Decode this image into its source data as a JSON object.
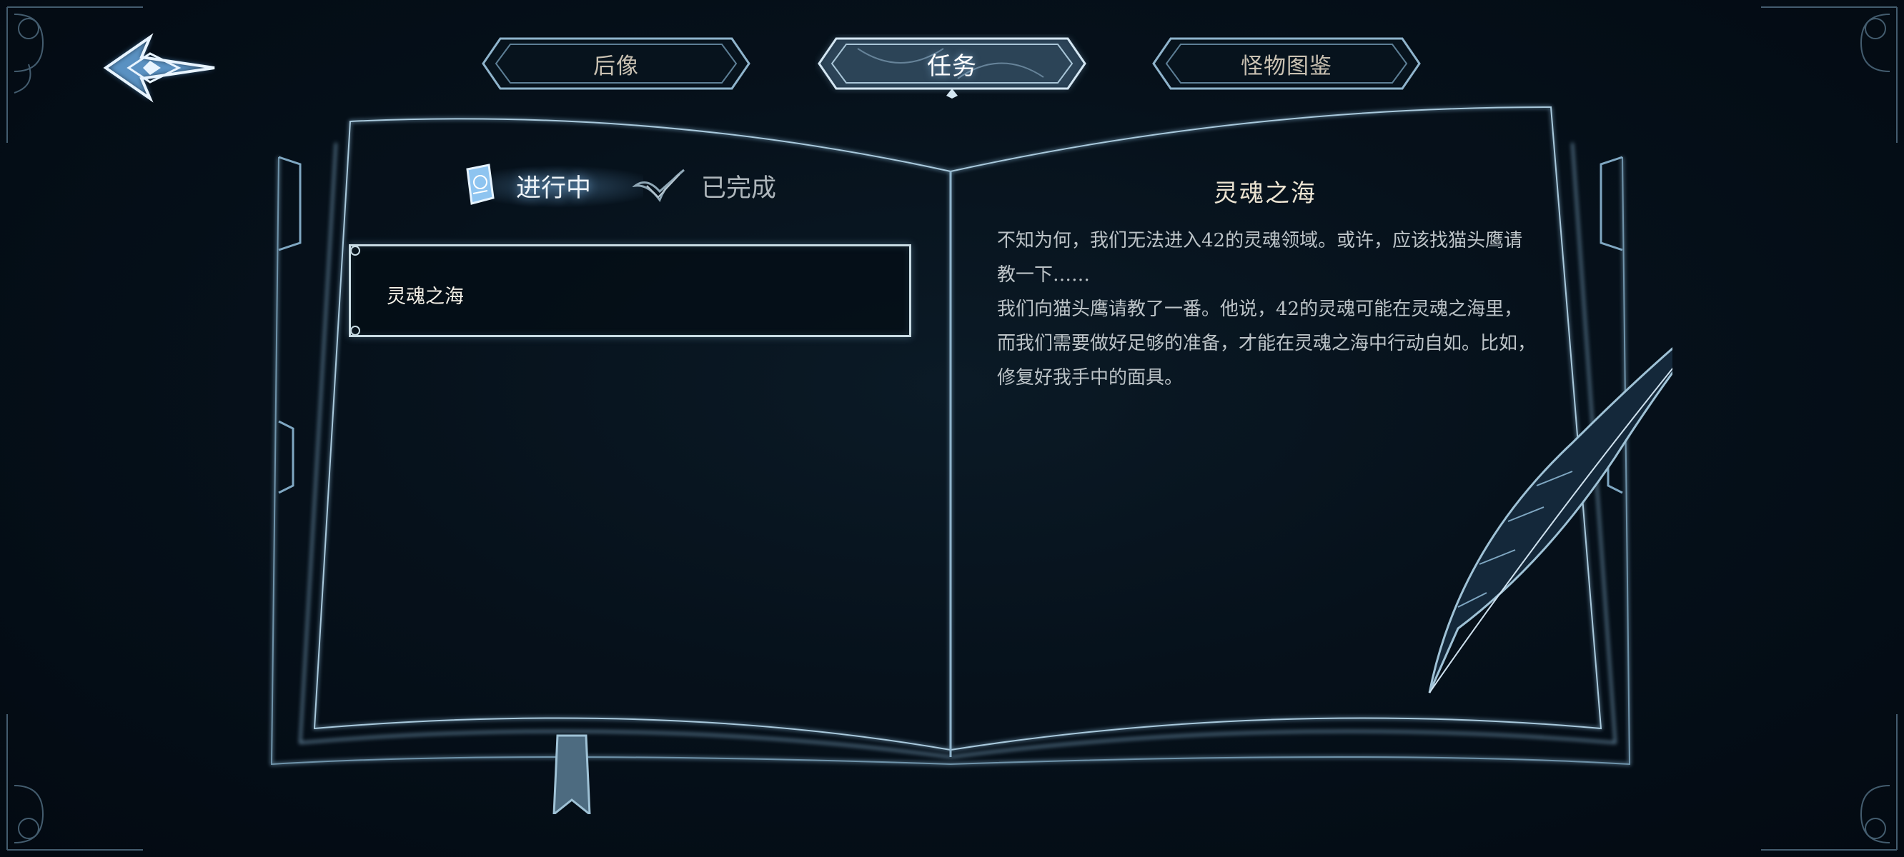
{
  "top_tabs": [
    {
      "label": "后像",
      "active": false
    },
    {
      "label": "任务",
      "active": true
    },
    {
      "label": "怪物图鉴",
      "active": false
    }
  ],
  "quest_log": {
    "subtabs": [
      {
        "label": "进行中",
        "active": true,
        "icon": "scroll-icon"
      },
      {
        "label": "已完成",
        "active": false,
        "icon": "quill-check-icon"
      }
    ],
    "entries": [
      {
        "name": "灵魂之海",
        "selected": true
      }
    ]
  },
  "detail": {
    "title": "灵魂之海",
    "paragraphs": [
      "不知为何，我们无法进入42的灵魂领域。或许，应该找猫头鹰请教一下……",
      "我们向猫头鹰请教了一番。他说，42的灵魂可能在灵魂之海里，而我们需要做好足够的准备，才能在灵魂之海中行动自如。比如，修复好我手中的面具。"
    ]
  },
  "colors": {
    "background": "#06111b",
    "line_glow": "#8fb4cc",
    "accent_light": "#c8dbe3",
    "text_title": "#ece4d2",
    "text_body": "#bcc3c7"
  },
  "icons": [
    "back-arrow-icon",
    "scroll-icon",
    "quill-check-icon",
    "feather-quill-icon",
    "bookmark-ribbon-icon",
    "corner-ornament-icon"
  ]
}
